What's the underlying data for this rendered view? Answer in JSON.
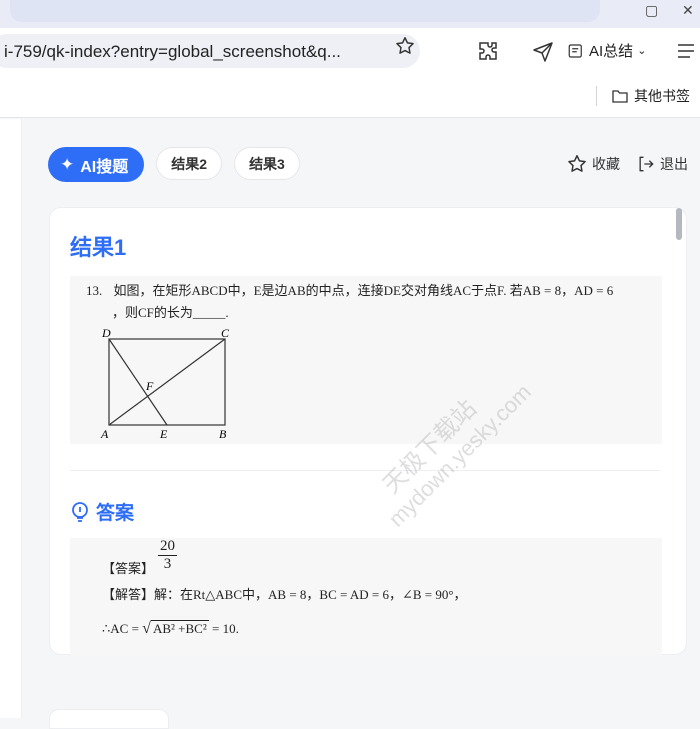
{
  "browser": {
    "url": "i-759/qk-index?entry=global_screenshot&q...",
    "ai_summary_label": "AI总结",
    "bookmarks_folder": "其他书签"
  },
  "toolbar": {
    "ai_search_label": "AI搜题",
    "tabs": [
      "结果2",
      "结果3"
    ],
    "favorite_label": "收藏",
    "exit_label": "退出"
  },
  "result": {
    "title": "结果1",
    "question_number": "13.",
    "question_line1": "如图，在矩形ABCD中，E是边AB的中点，连接DE交对角线AC于点F. 若AB = 8，AD = 6",
    "question_line2": "，则CF的长为_____.",
    "figure_labels": {
      "D": "D",
      "C": "C",
      "F": "F",
      "A": "A",
      "E": "E",
      "B": "B"
    }
  },
  "answer": {
    "heading": "答案",
    "answer_prefix": "【答案】",
    "fraction_num": "20",
    "fraction_den": "3",
    "explain_line": "【解答】解：在Rt△ABC中，AB = 8，BC = AD = 6，∠B = 90°，",
    "calc_prefix": "∴AC =",
    "calc_radicand": "AB² +BC²",
    "calc_result": "= 10."
  },
  "watermark": {
    "text1": "天极下载站",
    "text2": "mydown.yesky.com"
  },
  "colors": {
    "accent": "#2e6ef6",
    "page_bg": "#f5f6f8"
  }
}
